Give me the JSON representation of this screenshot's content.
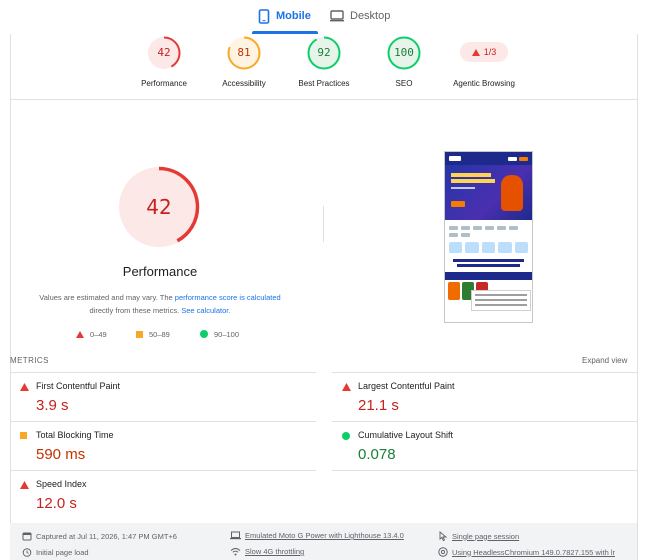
{
  "tabs": {
    "mobile": "Mobile",
    "desktop": "Desktop"
  },
  "summary": {
    "gauges": [
      {
        "score": "42",
        "label": "Performance",
        "color": "#c5221f"
      },
      {
        "score": "81",
        "label": "Accessibility",
        "color": "#c33300"
      },
      {
        "score": "92",
        "label": "Best Practices",
        "color": "#188038"
      },
      {
        "score": "100",
        "label": "SEO",
        "color": "#188038"
      }
    ],
    "agentic": {
      "value": "1/3",
      "label": "Agentic Browsing"
    }
  },
  "performance": {
    "score": "42",
    "title": "Performance",
    "disclaimer_pre": "Values are estimated and may vary. The",
    "disclaimer_link1": "performance score is calculated",
    "disclaimer_mid": "directly from these metrics.",
    "disclaimer_link2": "See calculator."
  },
  "legend": {
    "fail": "0–49",
    "average": "50–89",
    "pass": "90–100"
  },
  "metrics": {
    "title": "METRICS",
    "expand": "Expand view",
    "fcp": {
      "name": "First Contentful Paint",
      "value": "3.9 s"
    },
    "lcp": {
      "name": "Largest Contentful Paint",
      "value": "21.1 s"
    },
    "tbt": {
      "name": "Total Blocking Time",
      "value": "590 ms"
    },
    "cls": {
      "name": "Cumulative Layout Shift",
      "value": "0.078"
    },
    "si": {
      "name": "Speed Index",
      "value": "12.0 s"
    }
  },
  "footer": {
    "captured": "Captured at Jul 11, 2026, 1:47 PM GMT+6",
    "device": "Emulated Moto G Power with Lighthouse 13.4.0",
    "session": "Single page session",
    "load": "Initial page load",
    "throttle": "Slow 4G throttling",
    "browser": "Using HeadlessChromium 149.0.7827.155 with lr"
  }
}
